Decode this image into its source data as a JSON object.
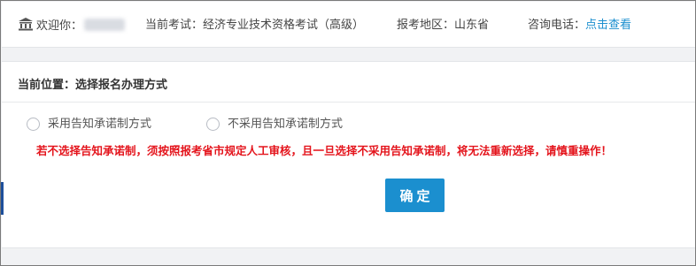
{
  "header": {
    "welcome_label": "欢迎你：",
    "exam_label": "当前考试：经济专业技术资格考试（高级）",
    "region_label": "报考地区：山东省",
    "phone_label": "咨询电话：",
    "phone_link": "点击查看"
  },
  "breadcrumb": {
    "text": "当前位置：选择报名办理方式"
  },
  "options": [
    {
      "label": "采用告知承诺制方式",
      "selected": false
    },
    {
      "label": "不采用告知承诺制方式",
      "selected": false
    }
  ],
  "warning": "若不选择告知承诺制，须按照报考省市规定人工审核，且一旦选择不采用告知承诺制，将无法重新选择，请慎重操作！",
  "confirm_label": "确定",
  "colors": {
    "accent": "#1b8fcf",
    "warning": "#e4141c",
    "background": "#f1f2f4"
  },
  "icons": {
    "welcome": "bank-icon"
  }
}
